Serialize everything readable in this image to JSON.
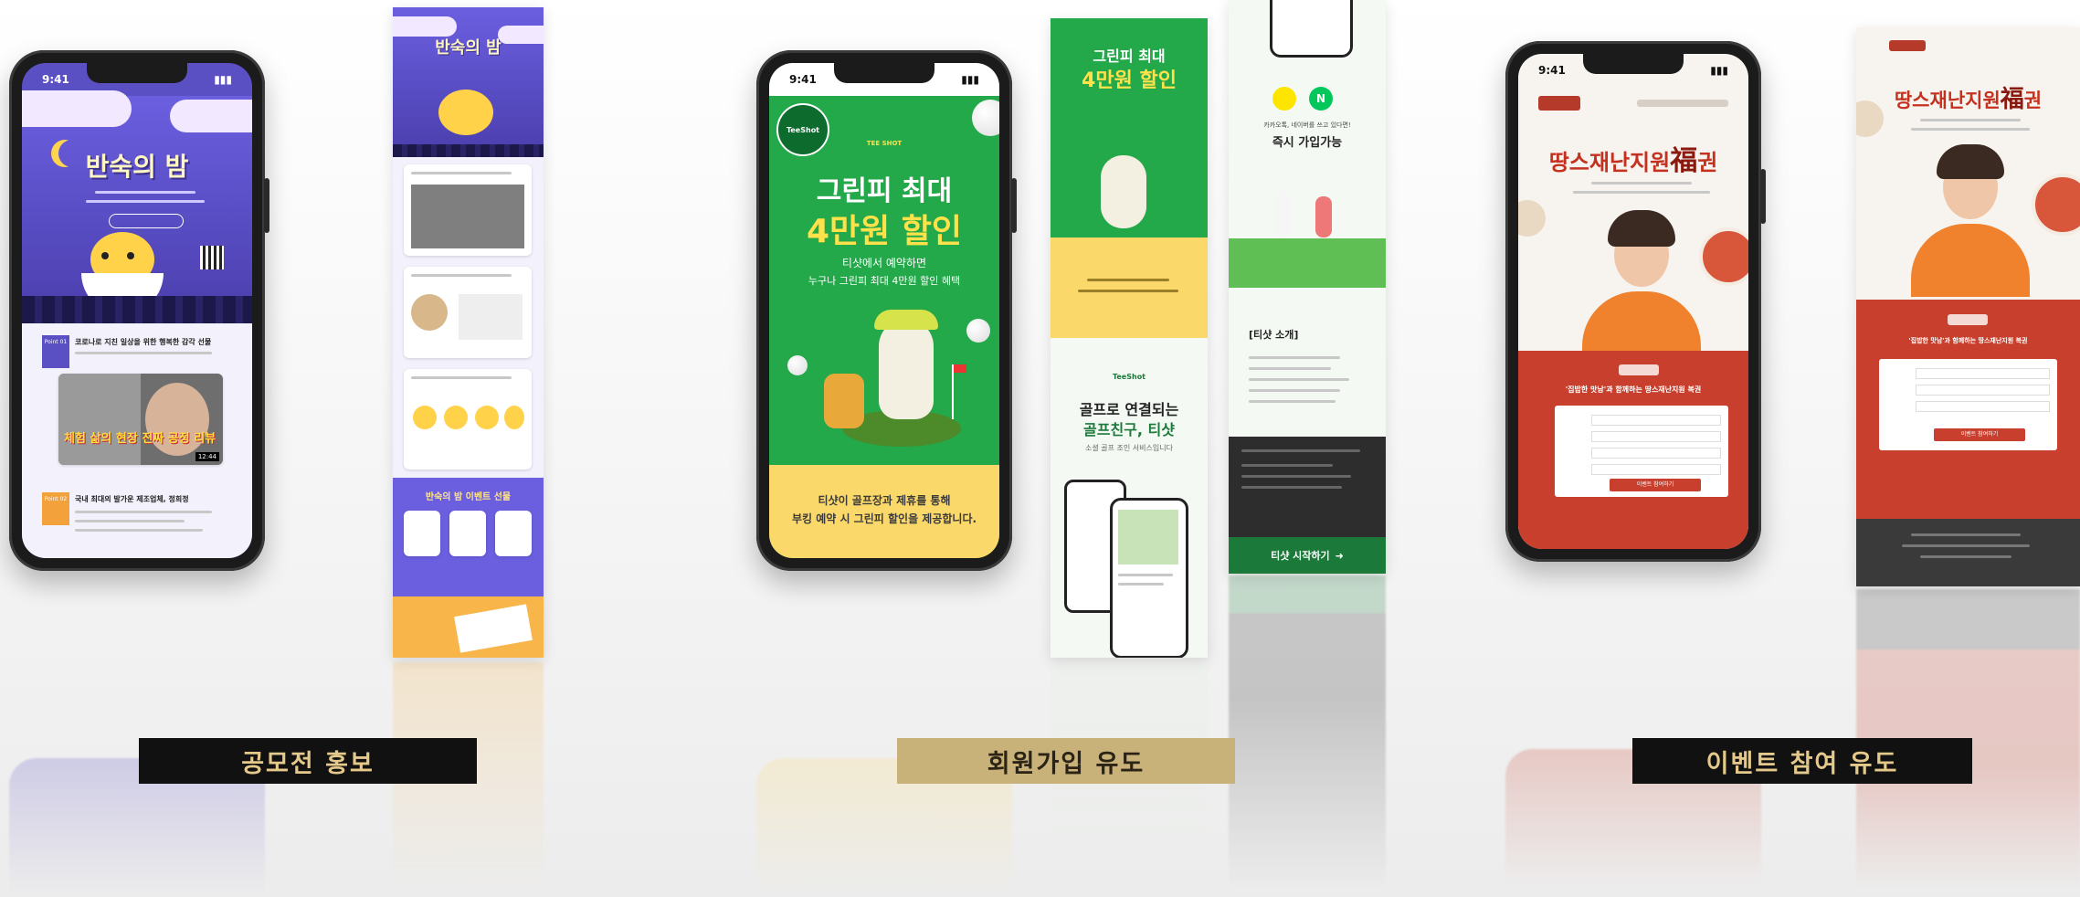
{
  "categories": [
    {
      "label": "공모전 홍보",
      "label_color": "#e4c98a",
      "box_color": "#111111"
    },
    {
      "label": "회원가입 유도",
      "label_color": "#2b2416",
      "box_color": "#c8b27a"
    },
    {
      "label": "이벤트 참여 유도",
      "label_color": "#e4c98a",
      "box_color": "#111111"
    }
  ],
  "status_time": "9:41",
  "contest": {
    "title": "반숙의 밤",
    "badge": "Point 01",
    "point1_title": "코로나로 지친 일상을 위한 행복한 감각 선물",
    "video_caption": "체험 삶의 현장 진짜 공정 리뷰",
    "video_time": "12:44",
    "badge2": "Point 02",
    "point2_title": "국내 최대의 발가운 제조업체, 정희정",
    "strip_heading": "반숙의 밤 이벤트 선물"
  },
  "teeshot": {
    "logo": "TeeShot",
    "tee_label": "TEE SHOT",
    "headline1": "그린피 최대",
    "headline2": "4만원 할인",
    "sub1": "티샷에서 예약하면",
    "sub2": "누구나 그린피 최대 4만원 할인 혜택",
    "footer1": "티샷이 골프장과 제휴를 통해",
    "footer2": "부킹 예약 시 그린피 할인을 제공합니다.",
    "strip_title1": "골프로 연결되는",
    "strip_title2": "골프친구, 티샷",
    "strip_sub": "소셜 골프 조인 서비스입니다",
    "join_title": "즉시 가입가능",
    "join_sub": "카카오톡, 네이버를 쓰고 있다면!",
    "about": "[티샷 소개]",
    "cta": "티샷 시작하기"
  },
  "event": {
    "headline_pre": "땅스재난지원",
    "headline_char": "福",
    "headline_post": "권",
    "banner": "'집밥한 맛남'과 함께하는 땅스재난지원 복권",
    "submit": "이벤트 참여하기"
  }
}
